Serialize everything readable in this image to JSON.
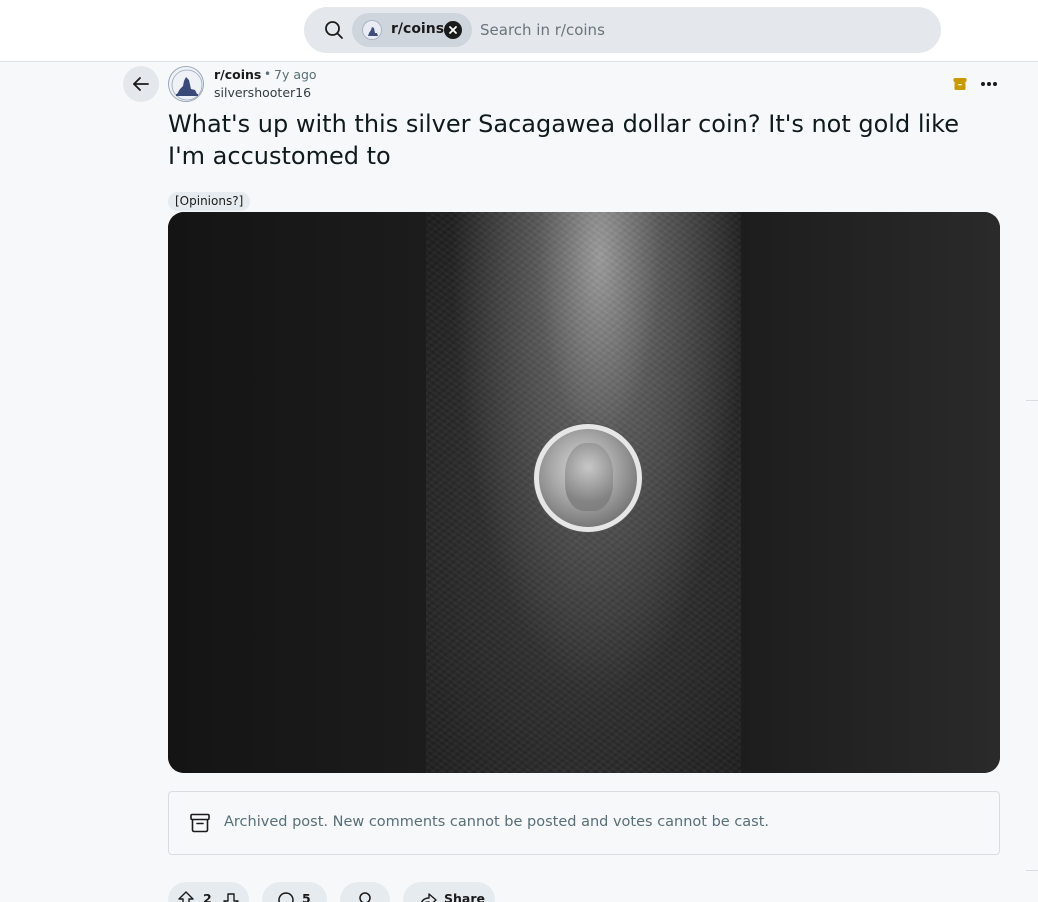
{
  "search": {
    "chip_label": "r/coins",
    "placeholder": "Search in r/coins"
  },
  "post": {
    "subreddit": "r/coins",
    "separator": "•",
    "age": "7y ago",
    "author": "silvershooter16",
    "title": "What's up with this silver Sacagawea dollar coin? It's not gold like I'm accustomed to",
    "flair": "[Opinions?]",
    "archived_notice": "Archived post. New comments cannot be posted and votes cannot be cast.",
    "vote_count": "2",
    "comment_count": "5",
    "share_label": "Share"
  },
  "colors": {
    "archive_badge": "#c99a00",
    "chip_bg": "#cfd5dd",
    "pill_bg": "#e5ebee"
  },
  "icons": [
    "search-icon",
    "close-icon",
    "back-arrow-icon",
    "archive-icon",
    "more-icon",
    "upvote-icon",
    "downvote-icon",
    "comment-icon",
    "award-icon",
    "share-icon"
  ]
}
